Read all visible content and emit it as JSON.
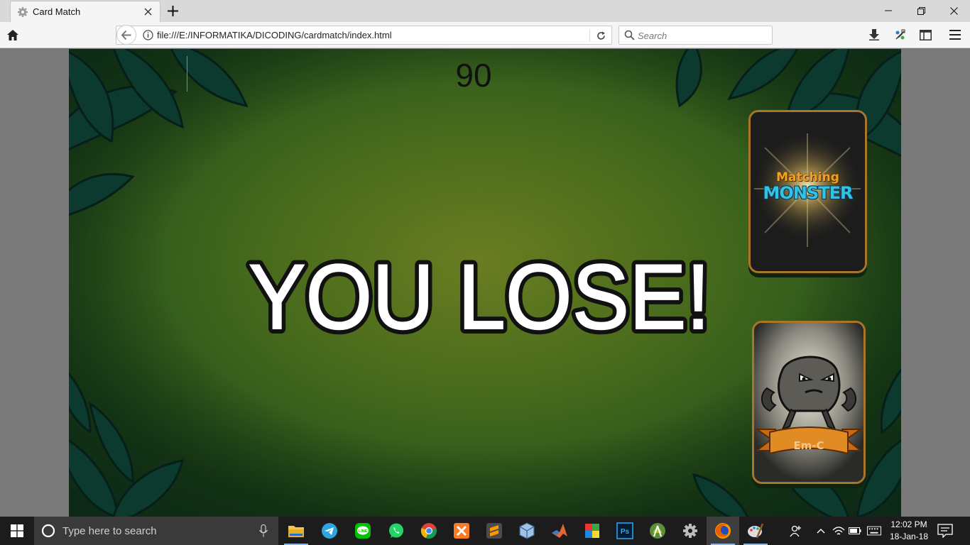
{
  "browser": {
    "tab_title": "Card Match",
    "url": "file:///E:/INFORMATIKA/DICODING/cardmatch/index.html",
    "search_placeholder": "Search"
  },
  "game": {
    "timer": "90",
    "message": "YOU LOSE!",
    "card_back": {
      "logo_top": "Matching",
      "logo_bottom": "MONSTER"
    },
    "card_face": {
      "monster_name": "Em-C"
    }
  },
  "taskbar": {
    "search_placeholder": "Type here to search",
    "apps": [
      "file-explorer",
      "telegram",
      "line",
      "whatsapp",
      "chrome",
      "xampp",
      "sublime-text",
      "virtualbox",
      "matlab",
      "winrar",
      "photoshop",
      "android-studio",
      "settings",
      "firefox",
      "paint"
    ],
    "time": "12:02 PM",
    "date": "18-Jan-18"
  },
  "colors": {
    "card_border": "#a8752b",
    "game_bg": "#4e6e1c",
    "taskbar_bg": "#1c1c1c"
  }
}
